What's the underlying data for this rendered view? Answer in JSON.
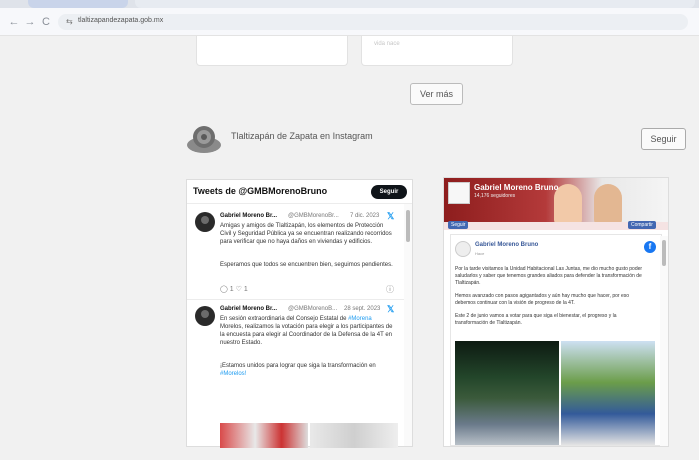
{
  "browser": {
    "url": "tlaltizapandezapata.gob.mx",
    "back_icon": "←",
    "forward_icon": "→",
    "reload_icon": "C",
    "site_info_icon": "⇆"
  },
  "cards": {
    "left_text": "",
    "right_text": "vida nace"
  },
  "ver_mas": "Ver más",
  "instagram": {
    "title": "Tlaltizapán de Zapata en Instagram",
    "follow": "Seguir"
  },
  "twitter": {
    "header": "Tweets de @GMBMorenoBruno",
    "follow": "Seguir",
    "tweets": [
      {
        "name": "Gabriel Moreno Br...",
        "handle": "@GMBMorenoBr...",
        "date": "7 dic. 2023",
        "body": "Amigas y amigos de Tlaltizapán, los elementos de Protección Civil y Seguridad Pública ya se encuentran realizando recorridos para verificar que no haya daños en viviendas y edificios.",
        "body2": "Esperamos que todos se encuentren bien, seguimos pendientes.",
        "replies": "1",
        "likes": "1"
      },
      {
        "name": "Gabriel Moreno Br...",
        "handle": "@GMBMorenoB...",
        "date": "28 sept. 2023",
        "body_pre": "En sesión extraordinaria del Consejo Estatal de ",
        "body_tag": "#Morena",
        "body_post": " Morelos, realizamos la votación para elegir a los participantes de la encuesta para elegir al Coordinador de la Defensa de la 4T en nuestro Estado.",
        "body2": "¡Estamos unidos para lograr que siga la transformación en",
        "body2_tag": "#Morelos!"
      }
    ]
  },
  "facebook": {
    "page_name": "Gabriel Moreno Bruno",
    "page_sub": "14,176 seguidores",
    "follow_label": "Seguir",
    "share_label": "Compartir",
    "post_name": "Gabriel Moreno Bruno",
    "post_time": "Hace",
    "p1": "Por la tarde visitamos la Unidad Habitacional Las Juntas, me dio mucho gusto poder saludarlos y saber que tenemos grandes aliados para defender la transformación de Tlaltizapán.",
    "p2": "Hemos avanzado con pasos agigantados y aún hay mucho que hacer, por eso debemos continuar con la visión de progreso de la 4T.",
    "p3": "Este 2 de junio vamos a votar para que siga el bienestar, el progreso y la transformación de Tlaltizapán."
  }
}
